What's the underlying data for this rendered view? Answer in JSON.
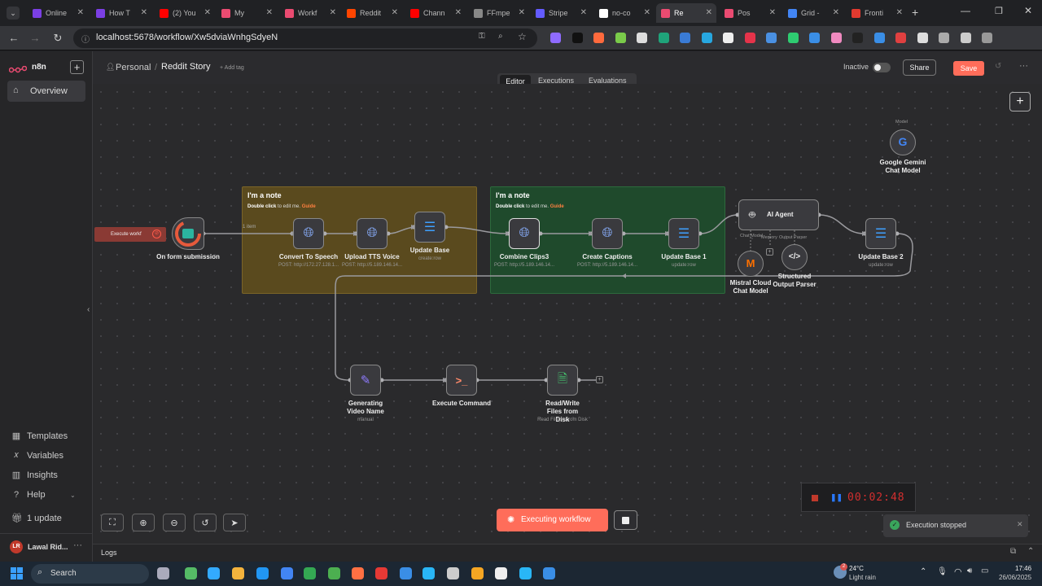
{
  "browser": {
    "tabs": [
      {
        "label": "Online",
        "color": "#7b3fe4"
      },
      {
        "label": "How T",
        "color": "#7b3fe4"
      },
      {
        "label": "(2) You",
        "color": "#ff0000"
      },
      {
        "label": "My",
        "color": "#ea4b71"
      },
      {
        "label": "Workf",
        "color": "#ea4b71"
      },
      {
        "label": "Reddit",
        "color": "#ff4500"
      },
      {
        "label": "Chann",
        "color": "#ff0000"
      },
      {
        "label": "FFmpe",
        "color": "#888888"
      },
      {
        "label": "Stripe",
        "color": "#635bff"
      },
      {
        "label": "no-co",
        "color": "#ffffff"
      },
      {
        "label": "Re",
        "color": "#ea4b71"
      },
      {
        "label": "Pos",
        "color": "#ea4b71"
      },
      {
        "label": "Grid -",
        "color": "#4285f4"
      },
      {
        "label": "Fronti",
        "color": "#e23a2f"
      }
    ],
    "url": "localhost:5678/workflow/Xw5dviaWnhgSdyeN"
  },
  "app": {
    "logo": "n8n",
    "breadcrumb_project": "Personal",
    "workflow_name": "Reddit Story",
    "add_tag": "+ Add tag",
    "tabs": [
      "Editor",
      "Executions",
      "Evaluations"
    ],
    "status": "Inactive",
    "share_label": "Share",
    "save_label": "Save"
  },
  "sidebar": {
    "overview": "Overview",
    "templates": "Templates",
    "variables": "Variables",
    "insights": "Insights",
    "help": "Help",
    "update": "1 update",
    "user": "Lawal Rid..."
  },
  "stickies": {
    "note1_title": "I'm a note",
    "note1_sub": "Double click",
    "note1_sub2": " to edit me. ",
    "note1_link": "Guide",
    "note2_title": "I'm a note",
    "note2_sub": "Double click",
    "note2_sub2": " to edit me. ",
    "note2_link": "Guide"
  },
  "nodes": {
    "trigger": {
      "label": "On form submission",
      "disabled_badge": "Execute workf"
    },
    "n1": {
      "label": "Convert To Speech",
      "sub": "POST: http://172.27.128.1..."
    },
    "n2": {
      "label": "Upload TTS Voice",
      "sub": "POST: http://5.189.146.14..."
    },
    "n3": {
      "label": "Update Base",
      "sub": "create:row"
    },
    "n4": {
      "label": "Combine Clips3",
      "sub": "POST: http://5.189.146.14..."
    },
    "n5": {
      "label": "Create Captions",
      "sub": "POST: http://5.189.146.14..."
    },
    "n6": {
      "label": "Update Base 1",
      "sub": "update:row"
    },
    "agent": {
      "label": "AI Agent",
      "chat_model": "Chat Model",
      "memory": "Memory",
      "output_parser": "Output Parser"
    },
    "n7": {
      "label": "Update Base 2",
      "sub": "update:row"
    },
    "gemini": {
      "label": "Google Gemini Chat Model",
      "tag": "Model"
    },
    "mistral": {
      "label": "Mistral Cloud Chat Model"
    },
    "parser": {
      "label": "Structured Output Parser"
    },
    "n8": {
      "label": "Generating Video Name",
      "sub": "manual"
    },
    "n9": {
      "label": "Execute Command"
    },
    "n10": {
      "label": "Read/Write Files from Disk",
      "sub": "Read File(s) From Disk"
    },
    "edge_label": "1 item"
  },
  "footer": {
    "executing": "Executing workflow",
    "logs": "Logs",
    "timer": "00:02:48",
    "toast": "Execution stopped"
  },
  "taskbar": {
    "search": "Search",
    "temp": "24°C",
    "weather": "Light rain",
    "time": "17:46",
    "date": "26/06/2025",
    "badge": "2"
  }
}
